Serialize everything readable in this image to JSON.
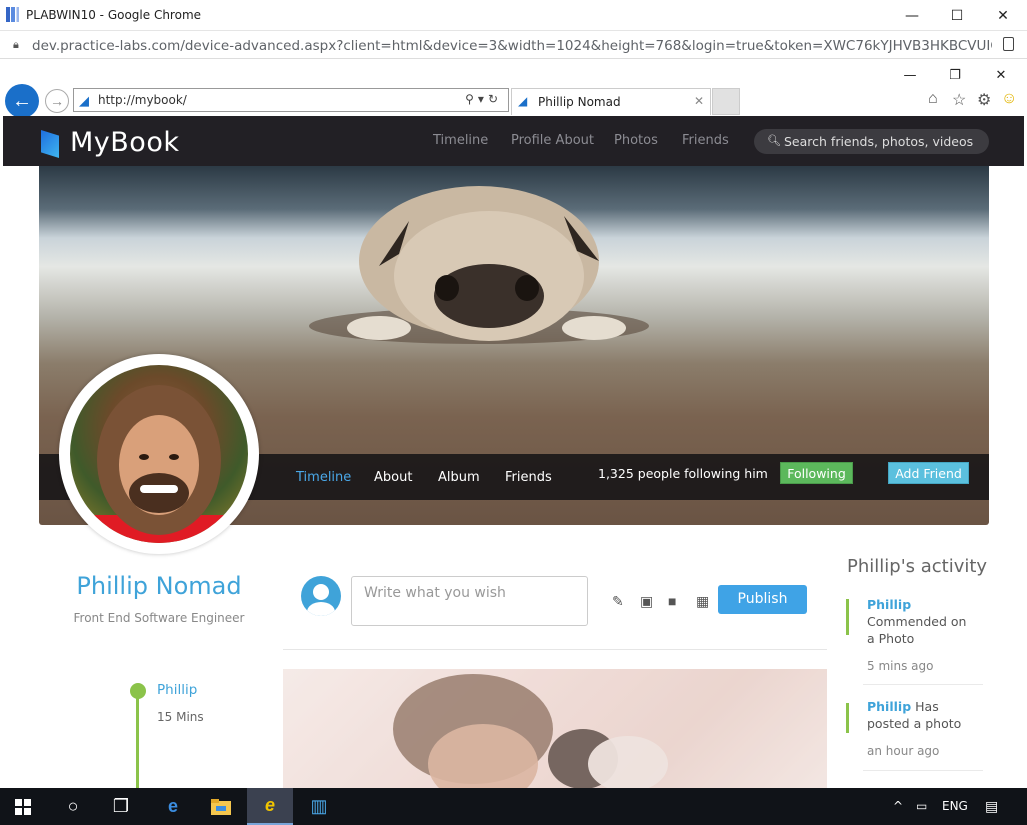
{
  "chrome": {
    "title": "PLABWIN10 - Google Chrome",
    "url": "dev.practice-labs.com/device-advanced.aspx?client=html&device=3&width=1024&height=768&login=true&token=XWC76kYJHVB3HKBCVUIQcLukJwQ..."
  },
  "ie": {
    "address": "http://mybook/",
    "tab_title": "Phillip Nomad"
  },
  "site": {
    "brand": "MyBook",
    "nav": [
      "Timeline",
      "Profile About",
      "Photos",
      "Friends"
    ],
    "search_placeholder": "Search friends, photos, videos"
  },
  "cover": {
    "tabs": [
      "Timeline",
      "About",
      "Album",
      "Friends"
    ],
    "followers": "1,325 people following him",
    "following_button": "Following",
    "add_friend_button": "Add Friend"
  },
  "profile": {
    "name": "Phillip Nomad",
    "role": "Front End Software Engineer",
    "timeline_name": "Phillip",
    "timeline_time": "15 Mins"
  },
  "post": {
    "placeholder": "Write what you wish",
    "publish": "Publish"
  },
  "activity": {
    "title": "Phillip's activity",
    "items": [
      {
        "name": "Phillip",
        "text": "Commended on a Photo",
        "time": "5 mins ago"
      },
      {
        "name": "Phillip",
        "text": "Has posted a photo",
        "time": "an hour ago"
      }
    ]
  },
  "taskbar": {
    "lang": "ENG"
  },
  "colors": {
    "accent": "#3fa3d9",
    "green": "#8bc34a",
    "navbar": "#222025"
  }
}
